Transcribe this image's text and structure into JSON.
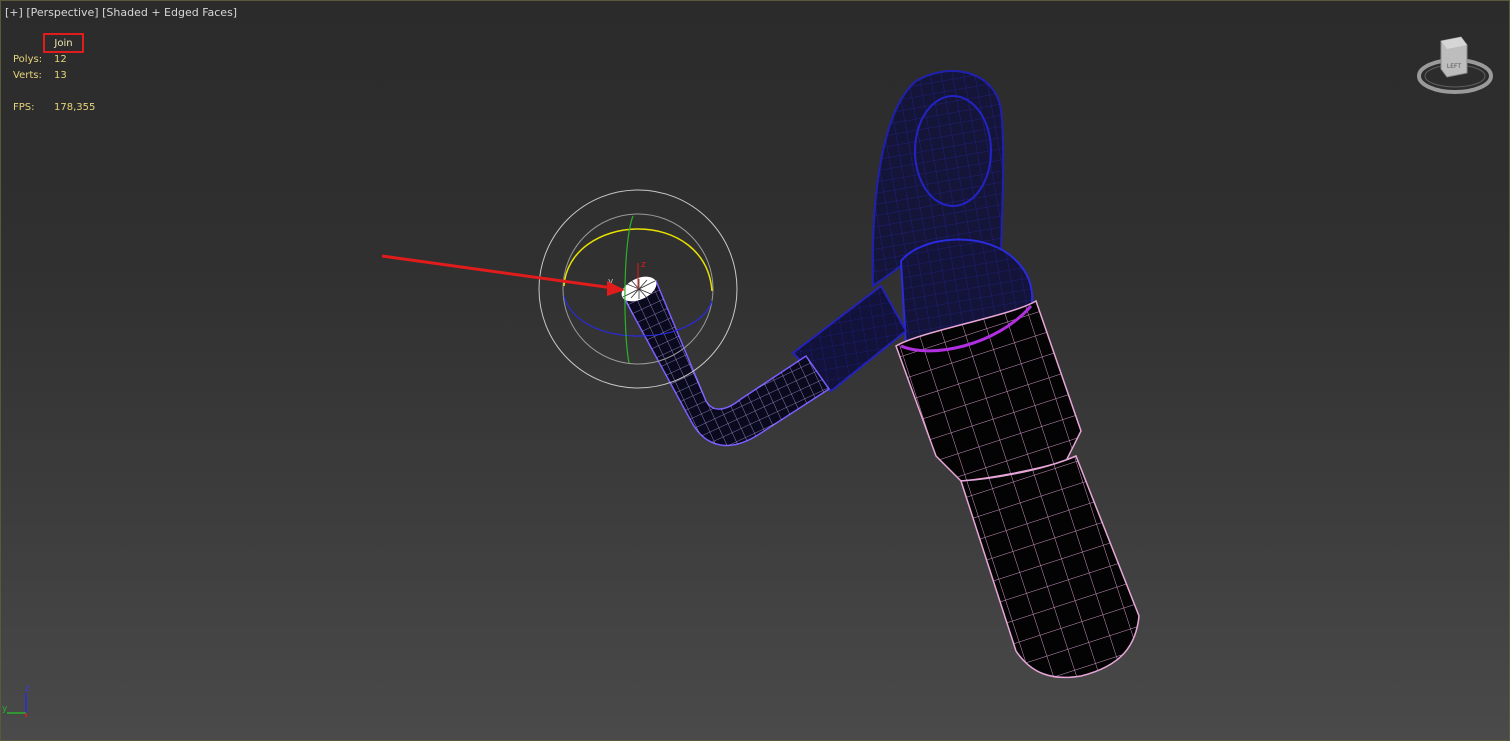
{
  "viewport": {
    "label_plus": "[+]",
    "label_view": "[Perspective]",
    "label_shading": "[Shaded + Edged Faces]"
  },
  "stats": {
    "join_label": "Join",
    "polys_label": "Polys:",
    "polys_value": "12",
    "verts_label": "Verts:",
    "verts_value": "13",
    "fps_label": "FPS:",
    "fps_value": "178,355"
  },
  "viewcube": {
    "face_label": "LEFT"
  },
  "gizmo": {
    "x_label": "x",
    "y_label": "y",
    "z_label": "z"
  },
  "tripod": {
    "z_label": "z",
    "y_label": "y"
  },
  "colors": {
    "annotation_red": "#e01c1c",
    "selection_blue": "#1a1a9a",
    "edge_pink": "#e7a6d8",
    "gizmo_yellow": "#e8e000",
    "gizmo_green": "#2bb02b",
    "gizmo_blue": "#2a2adf",
    "stat_yellow": "#e6d47a"
  }
}
